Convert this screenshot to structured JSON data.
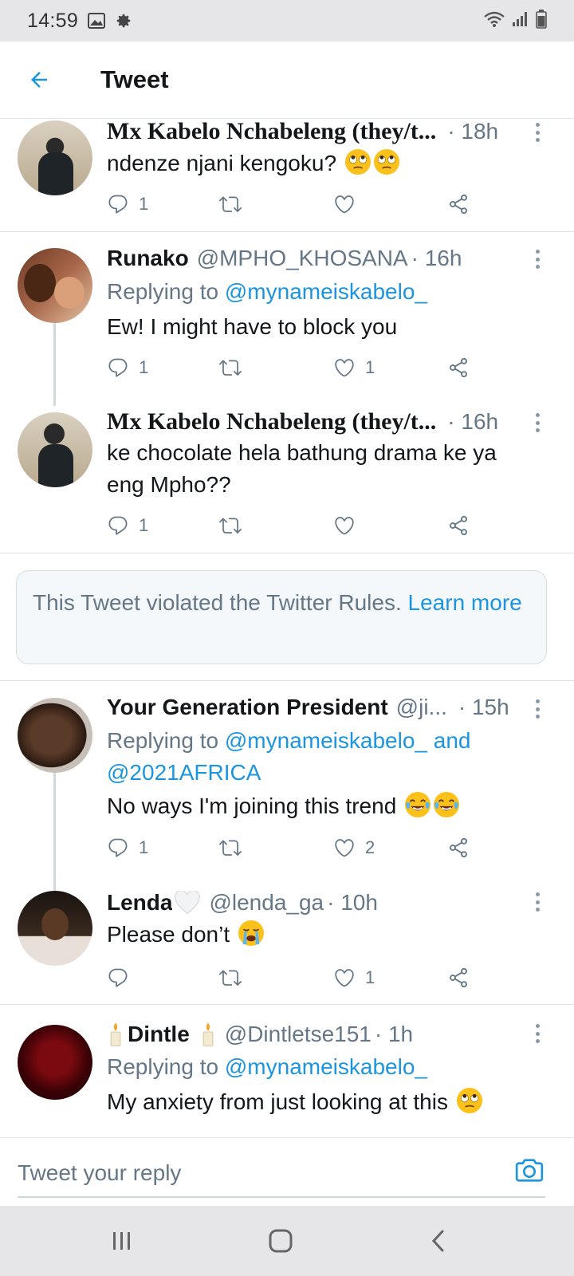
{
  "status_bar": {
    "time": "14:59",
    "icons": [
      "gallery-icon",
      "settings-gear-icon",
      "wifi-icon",
      "signal-icon",
      "battery-icon"
    ]
  },
  "header": {
    "title": "Tweet",
    "back_icon": "arrow-left-icon"
  },
  "colors": {
    "accent": "#1b95e0",
    "text": "#14171a",
    "muted": "#657786",
    "divider": "#dde3e8"
  },
  "tweets": [
    {
      "name": "Mx Kabelo Nchabeleng (they/t...",
      "handle": "",
      "time": "· 18h",
      "reply_prefix": "",
      "mentions": "",
      "text": "ndenze njani kengoku?",
      "emoji": [
        "face-with-rolling-eyes",
        "face-with-rolling-eyes"
      ],
      "replies": "1",
      "retweets": "",
      "likes": ""
    },
    {
      "name": "Runako",
      "handle": "@MPHO_KHOSANA",
      "time": "· 16h",
      "reply_prefix": "Replying to ",
      "mentions": "@mynameiskabelo_",
      "text": "Ew! I might have to block you",
      "emoji": [],
      "replies": "1",
      "retweets": "",
      "likes": "1"
    },
    {
      "name": "Mx Kabelo Nchabeleng (they/t...",
      "handle": "",
      "time": "· 16h",
      "reply_prefix": "",
      "mentions": "",
      "text": "ke chocolate hela bathung drama ke ya eng Mpho??",
      "emoji": [],
      "replies": "1",
      "retweets": "",
      "likes": ""
    },
    {
      "name": "Your Generation President",
      "handle": "@ji...",
      "time": "· 15h",
      "reply_prefix": "Replying to ",
      "mentions": "@mynameiskabelo_ and @2021AFRICA",
      "text": "No ways I'm joining this trend",
      "emoji": [
        "face-with-tears-of-joy",
        "face-with-tears-of-joy"
      ],
      "replies": "1",
      "retweets": "",
      "likes": "2"
    },
    {
      "name": "Lenda",
      "name_emoji": "white-heart",
      "handle": "@lenda_ga",
      "time": "· 10h",
      "reply_prefix": "",
      "mentions": "",
      "text": "Please don’t",
      "emoji": [
        "loudly-crying-face"
      ],
      "replies": "",
      "retweets": "",
      "likes": "1"
    },
    {
      "name": "Dintle",
      "name_emoji": "candle",
      "handle": "@Dintletse151",
      "time": "· 1h",
      "reply_prefix": "Replying to ",
      "mentions": "@mynameiskabelo_",
      "text": "My anxiety from just looking at this",
      "emoji": [
        "face-with-rolling-eyes"
      ],
      "replies": "",
      "retweets": "",
      "likes": ""
    }
  ],
  "notice": {
    "text": "This Tweet violated the Twitter Rules. ",
    "link": "Learn more"
  },
  "composer": {
    "placeholder": "Tweet your reply",
    "camera_icon": "camera-icon"
  },
  "nav_bar": {
    "icons": [
      "recent-apps-icon",
      "home-icon",
      "back-icon"
    ]
  }
}
